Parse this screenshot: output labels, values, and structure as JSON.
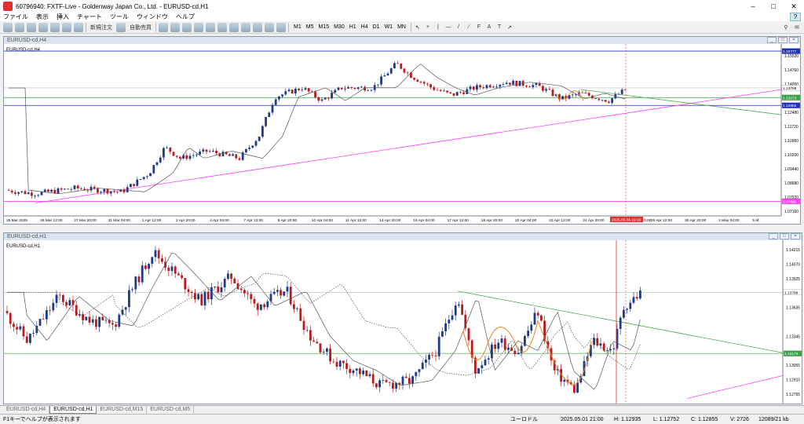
{
  "window": {
    "title": "60796940: FXTF-Live - Goldenway Japan Co., Ltd. - EURUSD-cd,H1"
  },
  "menu": [
    "ファイル",
    "表示",
    "挿入",
    "チャート",
    "ツール",
    "ウィンドウ",
    "ヘルプ"
  ],
  "toolbar": {
    "new_order": "新規注文",
    "auto_trade": "自動売買",
    "timeframes": [
      "M1",
      "M5",
      "M15",
      "M30",
      "H1",
      "H4",
      "D1",
      "W1",
      "MN"
    ]
  },
  "top_chart": {
    "window_title": "EURUSD-cd,H4",
    "label": "EURUSD-cd,H4",
    "price_scale": [
      "1.15520",
      "1.14760",
      "1.14000",
      "1.13240",
      "1.12480",
      "1.11720",
      "1.10960",
      "1.10200",
      "1.09440",
      "1.08680",
      "1.07920",
      "1.07160"
    ],
    "time_labels": [
      "25 Mar 2025",
      "26 Mar 12:00",
      "27 Mar 20:00",
      "31 Mar 04:00",
      "1 Apr 12:00",
      "2 Apr 20:00",
      "4 Apr 04:00",
      "7 Apr 12:00",
      "8 Apr 20:00",
      "10 Apr 04:00",
      "11 Apr 12:00",
      "14 Apr 20:00",
      "16 Apr 04:00",
      "17 Apr 12:00",
      "18 Apr 20:00",
      "22 Apr 04:00",
      "23 Apr 12:00",
      "24 Apr 20:00",
      "28 Apr 04:00",
      "29 Apr 12:00",
      "30 Apr 20:00",
      "2 May 04:00",
      "5 M"
    ],
    "crosshair_time": "2025.05.06 19:16",
    "crosshair_time_tail": "0:00",
    "tags": {
      "blue_top": "1.15777",
      "current": "1.13788",
      "green": "1.13273",
      "blue_low": "1.12852",
      "magenta": "1.07685"
    }
  },
  "bottom_chart": {
    "window_title": "EURUSD-cd,H1",
    "label": "EURUSD-cd,H1",
    "price_scale": [
      "1.14215",
      "1.14070",
      "1.13925",
      "1.13635",
      "1.13345",
      "1.13055",
      "1.12910",
      "1.12765"
    ],
    "tags": {
      "current": "1.13788",
      "green": "1.13173"
    }
  },
  "tabs": [
    "EURUSD-cd,H4",
    "EURUSD-cd,H1",
    "EURUSD-cd,M15",
    "EURUSD-cd,M5"
  ],
  "active_tab": 1,
  "status": {
    "help": "F1キーでヘルプが表示されます",
    "profile": "ユーロドル",
    "datetime": "2025.05.01 21:00",
    "high": "H: 1.12935",
    "low": "L: 1.12752",
    "close": "C: 1.12855",
    "volume": "V: 2726",
    "traffic": "12089/21 kb"
  },
  "colors": {
    "bull": "#1e3a8a",
    "bear": "#b91c1c",
    "ma": "#555555",
    "green_line": "#4caf50",
    "magenta_line": "#ff40ff",
    "blue_line": "#2030c0",
    "orange": "#f08020"
  }
}
